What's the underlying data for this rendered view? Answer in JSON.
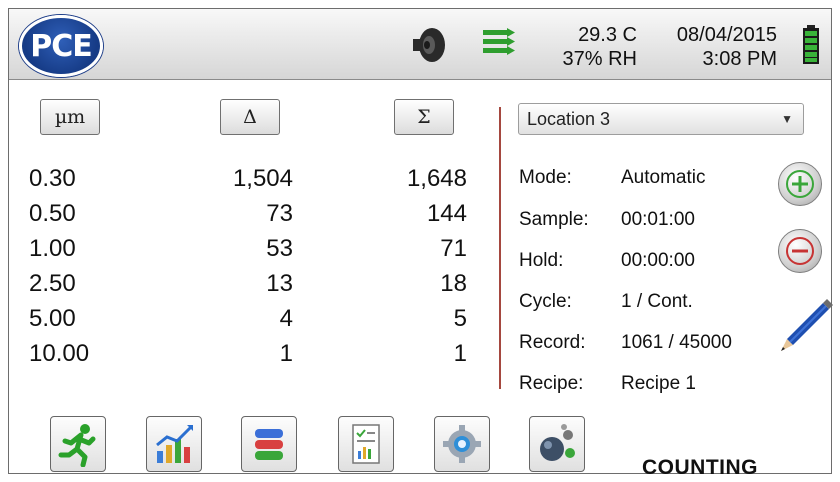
{
  "header": {
    "logo_text": "PCE",
    "temperature": "29.3 C",
    "humidity": "37% RH",
    "date": "08/04/2015",
    "time": "3:08 PM",
    "icons": [
      "speaker-icon",
      "data-transfer-arrows-icon",
      "battery-icon"
    ]
  },
  "columns": {
    "size_label": "µm",
    "delta_label": "Δ",
    "sum_label": "Σ"
  },
  "table": {
    "sizes": [
      "0.30",
      "0.50",
      "1.00",
      "2.50",
      "5.00",
      "10.00"
    ],
    "delta": [
      "1,504",
      "73",
      "53",
      "13",
      "4",
      "1"
    ],
    "sum": [
      "1,648",
      "144",
      "71",
      "18",
      "5",
      "1"
    ]
  },
  "location": {
    "selected": "Location 3"
  },
  "info": {
    "mode_label": "Mode:",
    "mode_value": "Automatic",
    "sample_label": "Sample:",
    "sample_value": "00:01:00",
    "hold_label": "Hold:",
    "hold_value": "00:00:00",
    "cycle_label": "Cycle:",
    "cycle_value": "1 / Cont.",
    "record_label": "Record:",
    "record_value": "1061 / 45000",
    "recipe_label": "Recipe:",
    "recipe_value": "Recipe 1"
  },
  "controls": [
    "plus-icon",
    "minus-icon",
    "pencil-icon"
  ],
  "toolbar": {
    "icons": [
      "runner-icon",
      "chart-icon",
      "database-icon",
      "report-icon",
      "settings-gear-icon",
      "particles-icon"
    ]
  },
  "status": "COUNTING",
  "colors": {
    "accent_green": "#2f9e2f",
    "logo_blue": "#163b86",
    "divider": "#a5483f"
  }
}
